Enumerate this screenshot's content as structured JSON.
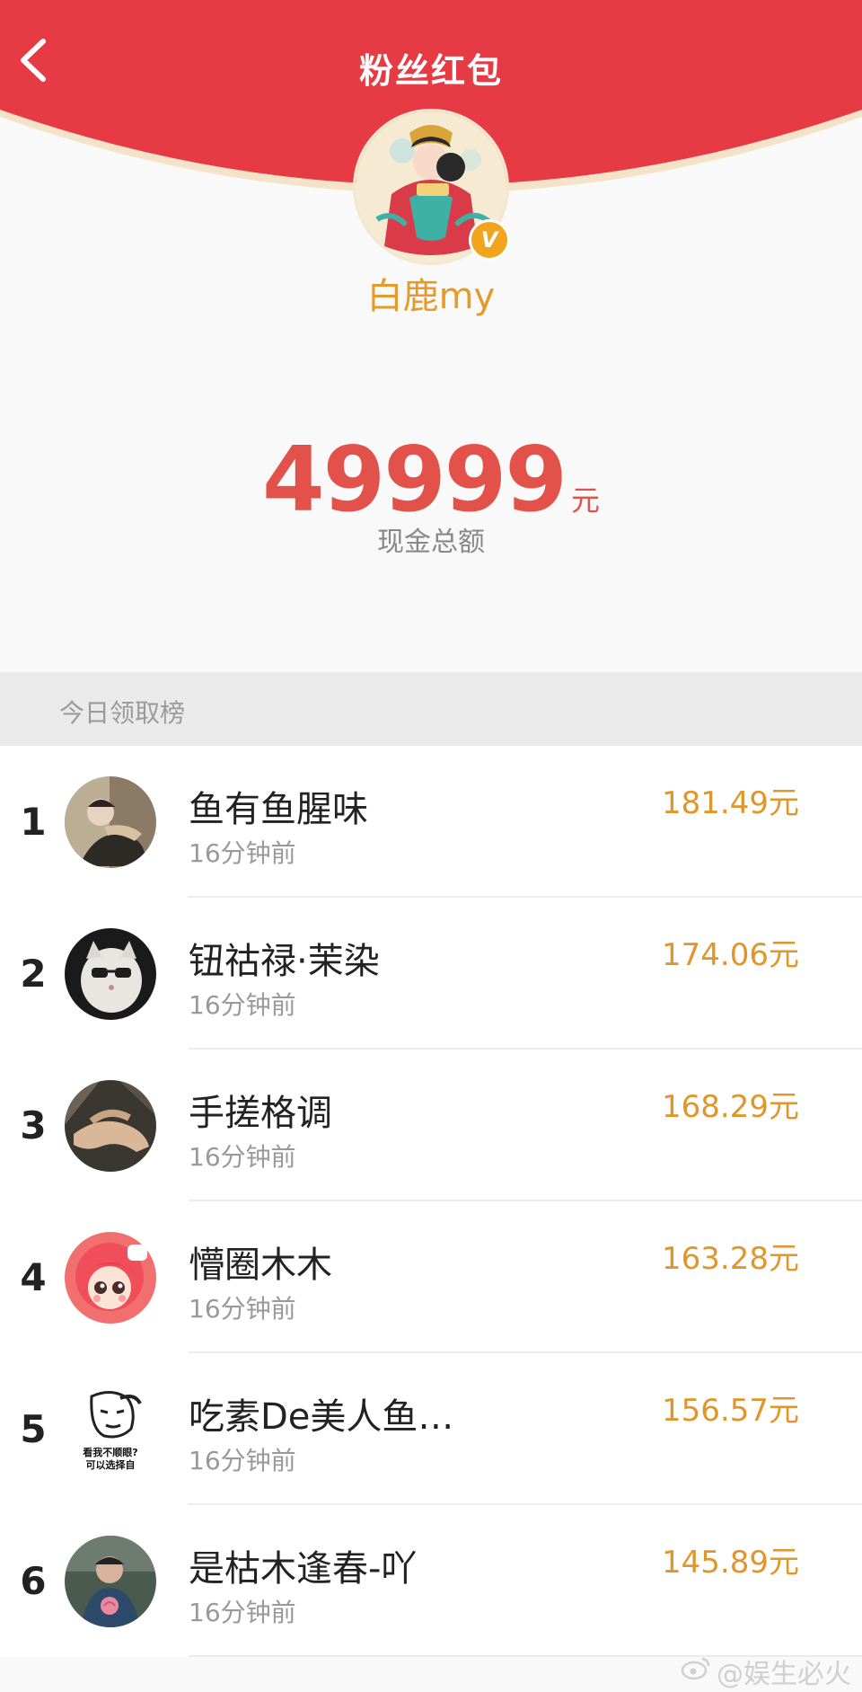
{
  "header": {
    "title": "粉丝红包",
    "back_icon": "chevron-left-icon"
  },
  "profile": {
    "username": "白鹿my",
    "verified_badge": "V"
  },
  "summary": {
    "amount": "49999",
    "unit": "元",
    "label": "现金总额"
  },
  "section": {
    "title": "今日领取榜"
  },
  "rankings": [
    {
      "rank": "1",
      "name": "鱼有鱼腥味",
      "time": "16分钟前",
      "amount": "181.49元"
    },
    {
      "rank": "2",
      "name": "钮祜禄·茉染",
      "time": "16分钟前",
      "amount": "174.06元"
    },
    {
      "rank": "3",
      "name": "手搓格调",
      "time": "16分钟前",
      "amount": "168.29元"
    },
    {
      "rank": "4",
      "name": "懵圈木木",
      "time": "16分钟前",
      "amount": "163.28元"
    },
    {
      "rank": "5",
      "name": "吃素De美人鱼…",
      "time": "16分钟前",
      "amount": "156.57元"
    },
    {
      "rank": "6",
      "name": "是枯木逢春-吖",
      "time": "16分钟前",
      "amount": "145.89元"
    }
  ],
  "avatar5_caption": [
    "看我不顺眼?",
    "可以选择自"
  ],
  "watermark": "@娱生必火",
  "colors": {
    "header_red": "#e63a44",
    "accent_orange": "#e0962b",
    "amount_red": "#e2524b"
  }
}
